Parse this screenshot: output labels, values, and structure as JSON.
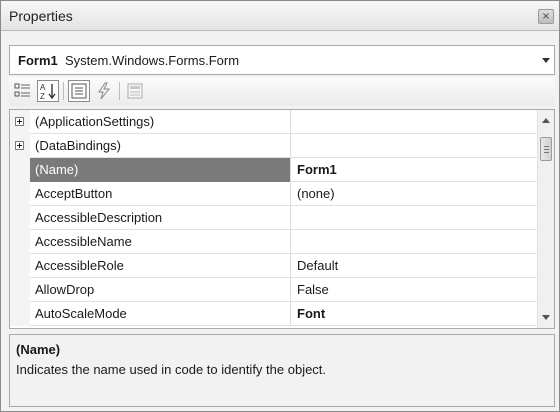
{
  "window": {
    "title": "Properties",
    "close_glyph": "×"
  },
  "object_selector": {
    "name": "Form1",
    "type": "System.Windows.Forms.Form"
  },
  "toolbar": {
    "buttons": [
      {
        "icon": "categorized-icon",
        "active": false
      },
      {
        "icon": "alphabetical-icon",
        "active": true
      },
      {
        "icon": "properties-icon",
        "active": true
      },
      {
        "icon": "events-lightning-icon",
        "active": false
      },
      {
        "icon": "property-pages-icon",
        "active": false
      }
    ]
  },
  "grid": {
    "rows": [
      {
        "name": "(ApplicationSettings)",
        "value": "",
        "expandable": true,
        "selected": false,
        "bold": false
      },
      {
        "name": "(DataBindings)",
        "value": "",
        "expandable": true,
        "selected": false,
        "bold": false
      },
      {
        "name": "(Name)",
        "value": "Form1",
        "expandable": false,
        "selected": true,
        "bold": true
      },
      {
        "name": "AcceptButton",
        "value": "(none)",
        "expandable": false,
        "selected": false,
        "bold": false
      },
      {
        "name": "AccessibleDescription",
        "value": "",
        "expandable": false,
        "selected": false,
        "bold": false
      },
      {
        "name": "AccessibleName",
        "value": "",
        "expandable": false,
        "selected": false,
        "bold": false
      },
      {
        "name": "AccessibleRole",
        "value": "Default",
        "expandable": false,
        "selected": false,
        "bold": false
      },
      {
        "name": "AllowDrop",
        "value": "False",
        "expandable": false,
        "selected": false,
        "bold": false
      },
      {
        "name": "AutoScaleMode",
        "value": "Font",
        "expandable": false,
        "selected": false,
        "bold": true
      }
    ]
  },
  "description": {
    "title": "(Name)",
    "text": "Indicates the name used in code to identify the object."
  },
  "colors": {
    "selected_row": "#7a7a7a",
    "window_bg": "#f2f2f2"
  }
}
